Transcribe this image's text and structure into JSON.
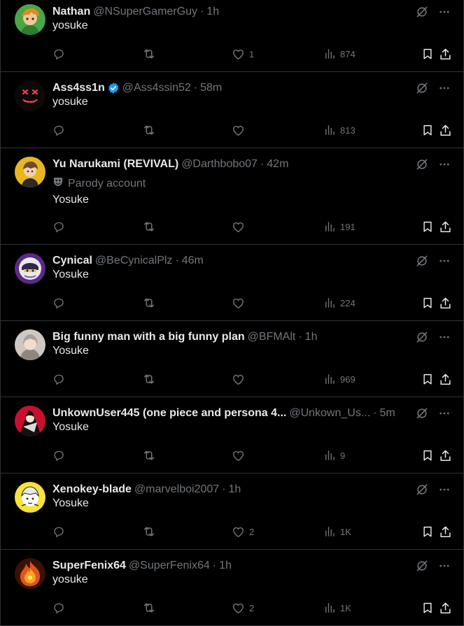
{
  "posts": [
    {
      "name": "Nathan",
      "handle": "@NSuperGamerGuy",
      "time": "1h",
      "text": "yosuke",
      "likes": "1",
      "views": "874",
      "verified": false,
      "parody": false,
      "avatar": "green-character"
    },
    {
      "name": "Ass4ss1n",
      "handle": "@Ass4ssin52",
      "time": "58m",
      "text": "yosuke",
      "likes": "",
      "views": "813",
      "verified": true,
      "parody": false,
      "avatar": "neon-mask"
    },
    {
      "name": "Yu Narukami (REVIVAL)",
      "handle": "@Darthbobo07",
      "time": "42m",
      "text": "Yosuke",
      "likes": "",
      "views": "191",
      "verified": false,
      "parody": true,
      "parody_label": "Parody account",
      "avatar": "anime-yellow"
    },
    {
      "name": "Cynical",
      "handle": "@BeCynicalPlz",
      "time": "46m",
      "text": "Yosuke",
      "likes": "",
      "views": "224",
      "verified": false,
      "parody": false,
      "avatar": "knight-purple"
    },
    {
      "name": "Big funny man with a big funny plan",
      "handle": "@BFMAlt",
      "time": "1h",
      "text": "Yosuke",
      "likes": "",
      "views": "969",
      "verified": false,
      "parody": false,
      "avatar": "grey-hair"
    },
    {
      "name": "UnkownUser445 (one piece and persona 4...",
      "handle": "@Unkown_Us...",
      "time": "5m",
      "text": "Yosuke",
      "likes": "",
      "views": "9",
      "verified": false,
      "parody": false,
      "avatar": "red-persona"
    },
    {
      "name": "Xenokey-blade",
      "handle": "@marvelboi2007",
      "time": "1h",
      "text": "Yosuke",
      "likes": "2",
      "views": "1K",
      "verified": false,
      "parody": false,
      "avatar": "yellow-manga"
    },
    {
      "name": "SuperFenix64",
      "handle": "@SuperFenix64",
      "time": "1h",
      "text": "yosuke",
      "likes": "2",
      "views": "1K",
      "verified": false,
      "parody": false,
      "avatar": "fire-phoenix"
    }
  ],
  "colors": {
    "background": "#000000",
    "text": "#e7e9ea",
    "muted": "#71767b",
    "border": "#2f3336",
    "verified": "#1d9bf0"
  },
  "icons": {
    "reply": "speech-bubble",
    "repost": "retweet-arrows",
    "like": "heart",
    "views": "bar-chart",
    "bookmark": "bookmark",
    "share": "upload-arrow",
    "grok": "slashed-circle",
    "more": "three-dots",
    "parody": "theater-mask"
  }
}
